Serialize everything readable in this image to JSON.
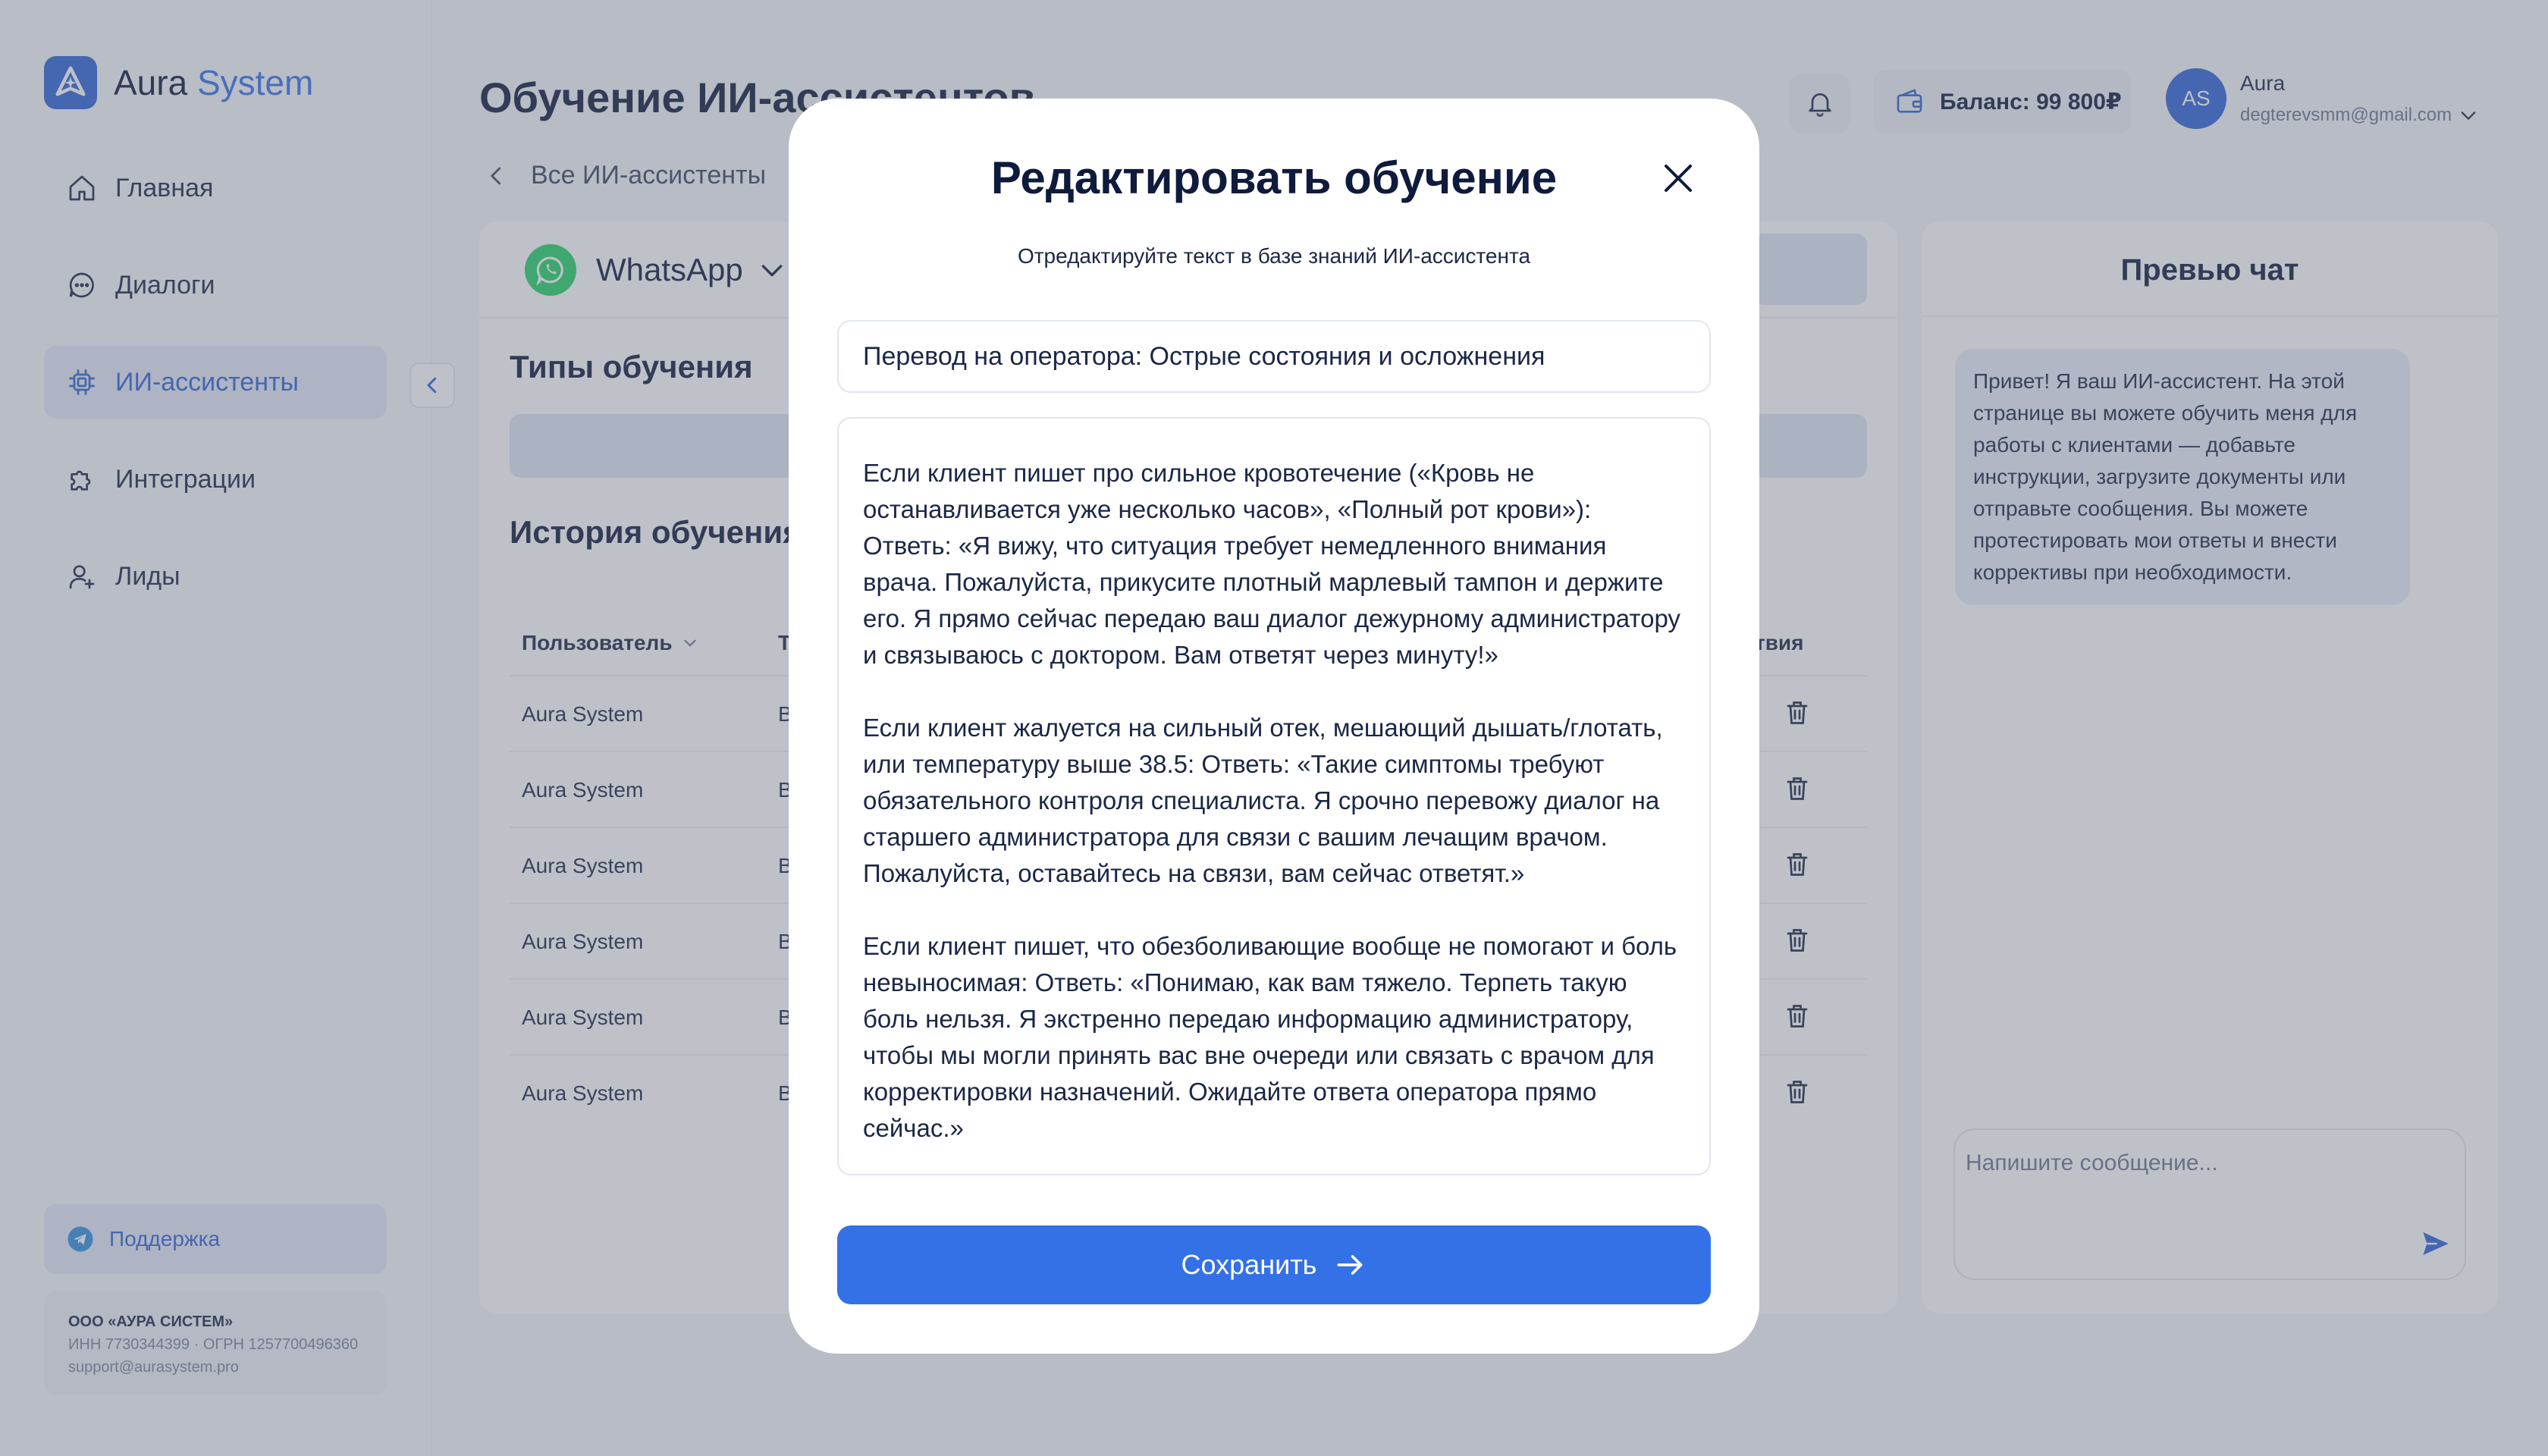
{
  "app": {
    "name_part1": "Aura",
    "name_part2": "System"
  },
  "sidebar": {
    "items": [
      {
        "label": "Главная",
        "icon": "home-icon"
      },
      {
        "label": "Диалоги",
        "icon": "chat-icon"
      },
      {
        "label": "ИИ-ассистенты",
        "icon": "chip-icon",
        "active": true
      },
      {
        "label": "Интеграции",
        "icon": "puzzle-icon"
      },
      {
        "label": "Лиды",
        "icon": "user-add-icon"
      }
    ],
    "support_label": "Поддержка",
    "company": {
      "name": "ООО «АУРА СИСТЕМ»",
      "ids": "ИНН 7730344399 · ОГРН 1257700496360",
      "email": "support@aurasystem.pro"
    }
  },
  "header": {
    "title": "Обучение ИИ-ассистентов",
    "back_label": "Все ИИ-ассистенты",
    "balance": "Баланс: 99 800₽",
    "user": {
      "initials": "AS",
      "name": "Aura",
      "email": "degterevsmm@gmail.com"
    }
  },
  "main": {
    "channel": "WhatsApp",
    "types_title": "Типы обучения",
    "history_title": "История обучения",
    "columns": {
      "user": "Пользователь",
      "type": "Т",
      "actions": "твия"
    },
    "rows": [
      {
        "user": "Aura System",
        "type": "В"
      },
      {
        "user": "Aura System",
        "type": "В"
      },
      {
        "user": "Aura System",
        "type": "В"
      },
      {
        "user": "Aura System",
        "type": "В"
      },
      {
        "user": "Aura System",
        "type": "В"
      },
      {
        "user": "Aura System",
        "type": "В"
      }
    ]
  },
  "preview": {
    "title": "Превью чат",
    "message": "Привет! Я ваш ИИ-ассистент. На этой странице вы можете обучить меня для работы с клиентами — добавьте инструкции, загрузите документы или отправьте сообщения. Вы можете протестировать мои ответы и внести коррективы при необходимости.",
    "input_placeholder": "Напишите сообщение..."
  },
  "modal": {
    "title": "Редактировать обучение",
    "subtitle": "Отредактируйте текст в базе знаний ИИ-ассистента",
    "title_value": "Перевод на оператора: Острые состояния и осложнения",
    "body_value": "Если клиент пишет про сильное кровотечение («Кровь не останавливается уже несколько часов», «Полный рот крови»): Ответь: «Я вижу, что ситуация требует немедленного внимания врача. Пожалуйста, прикусите плотный марлевый тампон и держите его. Я прямо сейчас передаю ваш диалог дежурному администратору и связываюсь с доктором. Вам ответят через минуту!»\n\nЕсли клиент жалуется на сильный отек, мешающий дышать/глотать, или температуру выше 38.5: Ответь: «Такие симптомы требуют обязательного контроля специалиста. Я срочно перевожу диалог на старшего администратора для связи с вашим лечащим врачом. Пожалуйста, оставайтесь на связи, вам сейчас ответят.»\n\nЕсли клиент пишет, что обезболивающие вообще не помогают и боль невыносимая: Ответь: «Понимаю, как вам тяжело. Терпеть такую боль нельзя. Я экстренно передаю информацию администратору, чтобы мы могли принять вас вне очереди или связать с врачом для корректировки назначений. Ожидайте ответа оператора прямо сейчас.»",
    "save_label": "Сохранить"
  },
  "colors": {
    "accent": "#3470e6",
    "whatsapp": "#25d366",
    "active_bg": "#e3e9f6"
  }
}
